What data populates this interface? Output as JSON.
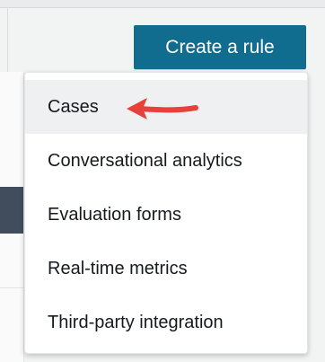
{
  "create_rule_button": {
    "label": "Create a rule"
  },
  "menu": {
    "items": [
      {
        "label": "Cases",
        "selected": true
      },
      {
        "label": "Conversational analytics",
        "selected": false
      },
      {
        "label": "Evaluation forms",
        "selected": false
      },
      {
        "label": "Real-time metrics",
        "selected": false
      },
      {
        "label": "Third-party integration",
        "selected": false
      }
    ]
  },
  "annotation": {
    "arrow_color": "#e8413b"
  },
  "colors": {
    "button_bg": "#116d8f",
    "button_text": "#ffffff",
    "selected_item_bg": "#eef0f1",
    "page_bg": "#f2f3f3",
    "dark_panel": "#414d5c"
  }
}
